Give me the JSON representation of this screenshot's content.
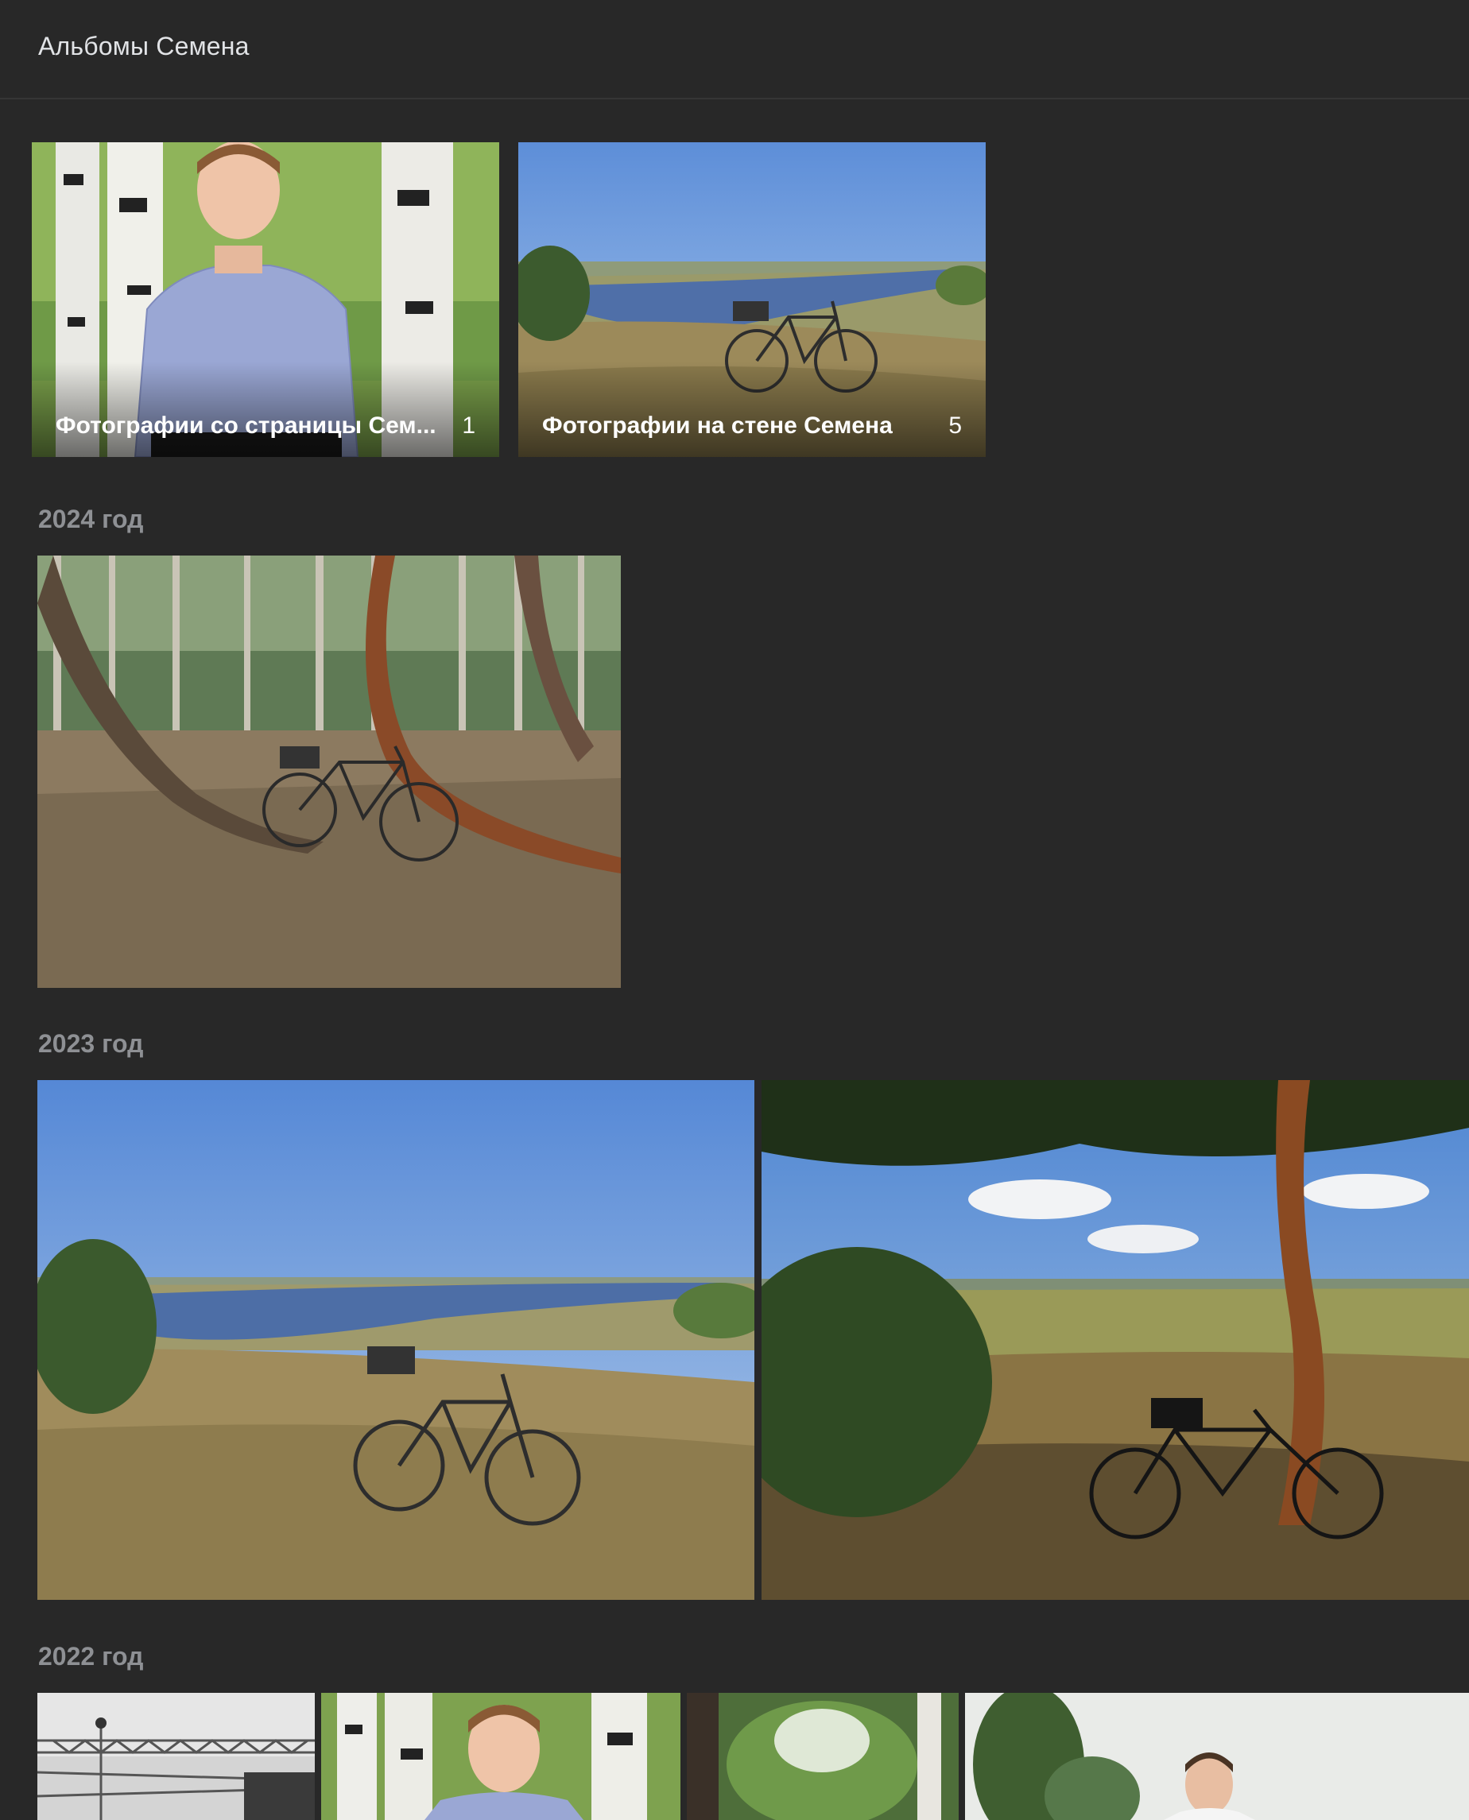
{
  "header": {
    "title": "Альбомы Семена"
  },
  "albums": [
    {
      "name": "Фотографии со страницы Сем...",
      "count": "1"
    },
    {
      "name": "Фотографии на стене Семена",
      "count": "5"
    }
  ],
  "sections": [
    {
      "year": "2024 год"
    },
    {
      "year": "2023 год"
    },
    {
      "year": "2022 год"
    }
  ]
}
